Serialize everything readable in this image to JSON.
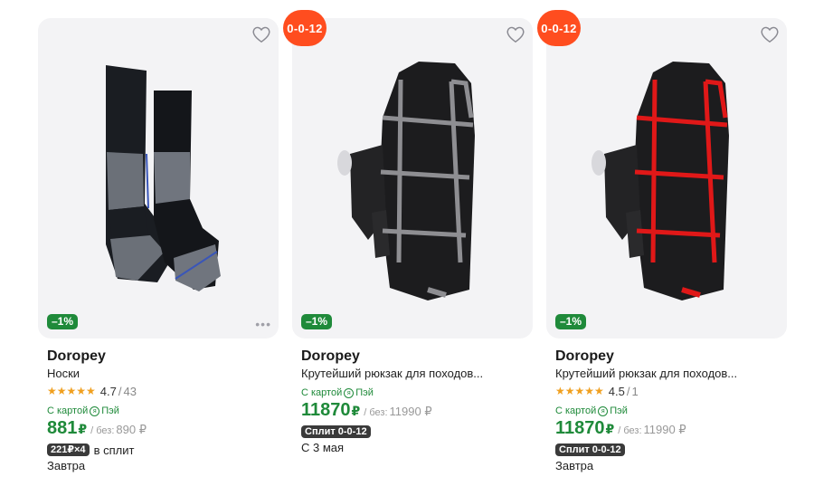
{
  "products": [
    {
      "brand": "Doropey",
      "title": "Носки",
      "discount": "–1%",
      "rating": "4.7",
      "reviews": "43",
      "card_label_before": "С картой",
      "card_label_after": "Пэй",
      "price": "881",
      "currency": "₽",
      "old_prefix": "/ без:",
      "old_price": "890 ₽",
      "split_tag": "221₽×4",
      "split_text": "в сплит",
      "delivery": "Завтра"
    },
    {
      "brand": "Doropey",
      "title": "Крутейший рюкзак для походов...",
      "discount": "–1%",
      "promo": "0-0-12",
      "card_label_before": "С картой",
      "card_label_after": "Пэй",
      "price": "11870",
      "currency": "₽",
      "old_prefix": "/ без:",
      "old_price": "11990 ₽",
      "split_tag": "Сплит 0-0-12",
      "delivery": "С 3 мая"
    },
    {
      "brand": "Doropey",
      "title": "Крутейший рюкзак для походов...",
      "discount": "–1%",
      "promo": "0-0-12",
      "rating": "4.5",
      "reviews": "1",
      "card_label_before": "С картой",
      "card_label_after": "Пэй",
      "price": "11870",
      "currency": "₽",
      "old_prefix": "/ без:",
      "old_price": "11990 ₽",
      "split_tag": "Сплит 0-0-12",
      "delivery": "Завтра"
    }
  ],
  "colors": {
    "accent_green": "#1f8a3a",
    "promo_orange": "#ff4d1f",
    "star": "#f0a020"
  },
  "icons": {
    "favorite": "heart-outline-icon",
    "pay": "pay-logo-icon",
    "more": "more-dots-icon"
  }
}
